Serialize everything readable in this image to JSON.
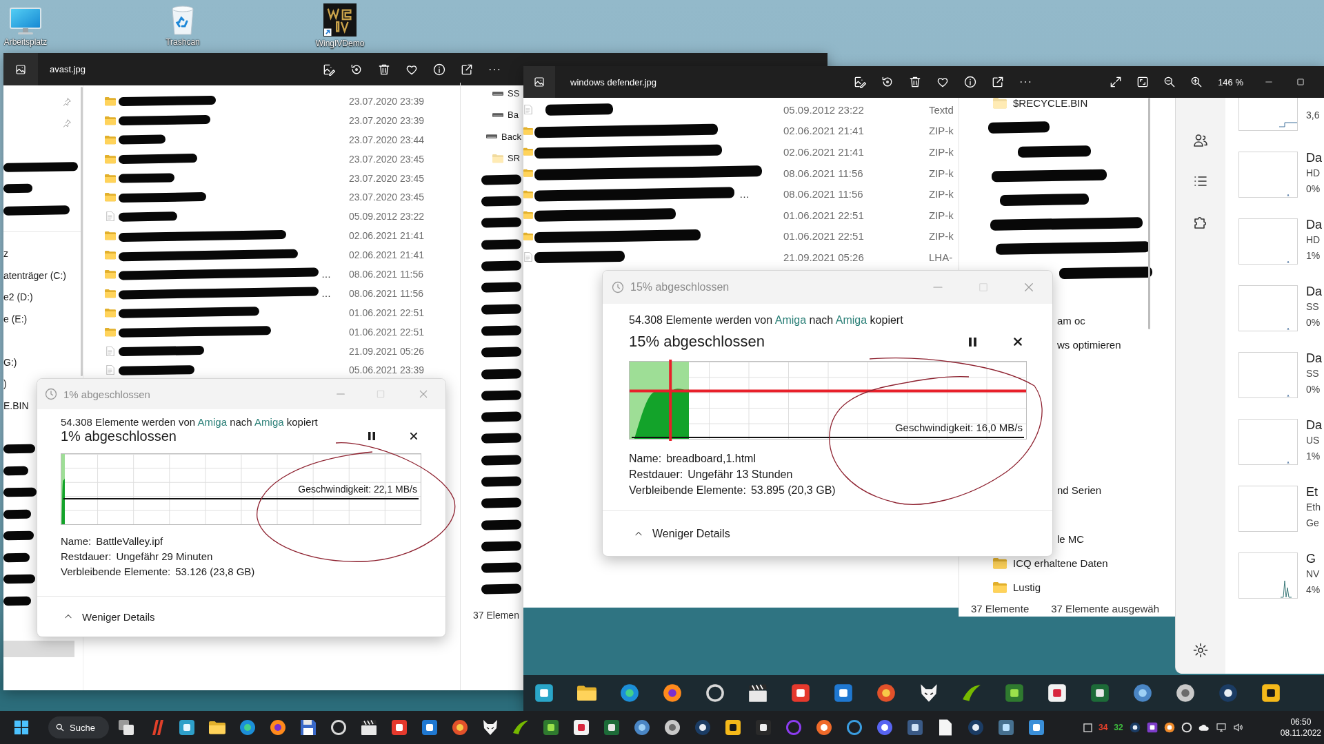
{
  "desktop_icons": [
    {
      "kind": "monitor",
      "label": "Arbeitsplatz"
    },
    {
      "kind": "recycle",
      "label": "Trashcan"
    },
    {
      "kind": "game",
      "label": "WingIVDemo"
    }
  ],
  "viewer_back": {
    "title": "avast.jpg",
    "nav_items": [
      {
        "kind": "pinned"
      },
      {
        "kind": "pinned"
      },
      {
        "kind": "redacted"
      },
      {
        "kind": "redacted"
      },
      {
        "kind": "redacted"
      },
      {
        "kind": "text",
        "label": "z"
      },
      {
        "kind": "text",
        "label": "atenträger (C:)"
      },
      {
        "kind": "text",
        "label": "e2 (D:)"
      },
      {
        "kind": "text",
        "label": "e (E:)"
      },
      {
        "kind": "text",
        "label": "G:)"
      },
      {
        "kind": "text",
        "label": ")"
      },
      {
        "kind": "text",
        "label": "E.BIN"
      },
      {
        "kind": "redacted"
      },
      {
        "kind": "redacted"
      },
      {
        "kind": "redacted"
      },
      {
        "kind": "redacted"
      },
      {
        "kind": "redacted"
      },
      {
        "kind": "redacted"
      },
      {
        "kind": "redacted"
      },
      {
        "kind": "redacted"
      }
    ],
    "files": [
      {
        "kind": "folder",
        "date": "23.07.2020 23:39"
      },
      {
        "kind": "folder",
        "date": "23.07.2020 23:39"
      },
      {
        "kind": "folder",
        "date": "23.07.2020 23:44"
      },
      {
        "kind": "folder",
        "date": "23.07.2020 23:45"
      },
      {
        "kind": "folder",
        "date": "23.07.2020 23:45"
      },
      {
        "kind": "folder",
        "date": "23.07.2020 23:45"
      },
      {
        "kind": "file",
        "date": "05.09.2012 23:22"
      },
      {
        "kind": "folder",
        "date": "02.06.2021 21:41"
      },
      {
        "kind": "folder",
        "date": "02.06.2021 21:41"
      },
      {
        "kind": "folder",
        "date": "08.06.2021 11:56",
        "tail": "…"
      },
      {
        "kind": "folder",
        "date": "08.06.2021 11:56",
        "tail": "…"
      },
      {
        "kind": "folder",
        "date": "01.06.2021 22:51"
      },
      {
        "kind": "folder",
        "date": "01.06.2021 22:51"
      },
      {
        "kind": "file",
        "date": "21.09.2021 05:26"
      },
      {
        "kind": "file",
        "date": "05.06.2021 23:39"
      }
    ],
    "side_items": [
      {
        "kind": "drive",
        "label": "SS"
      },
      {
        "kind": "drive",
        "label": "Ba"
      },
      {
        "kind": "drive_root",
        "label": "Back"
      },
      {
        "kind": "hidden_folder",
        "label": "SR"
      },
      {
        "kind": "redacted"
      },
      {
        "kind": "redacted"
      },
      {
        "kind": "redacted"
      },
      {
        "kind": "redacted"
      },
      {
        "kind": "redacted"
      },
      {
        "kind": "redacted"
      },
      {
        "kind": "redacted"
      },
      {
        "kind": "redacted"
      },
      {
        "kind": "redacted"
      },
      {
        "kind": "redacted"
      },
      {
        "kind": "redacted"
      },
      {
        "kind": "redacted"
      },
      {
        "kind": "redacted"
      },
      {
        "kind": "redacted"
      },
      {
        "kind": "redacted"
      },
      {
        "kind": "redacted"
      },
      {
        "kind": "redacted"
      },
      {
        "kind": "redacted"
      },
      {
        "kind": "redacted"
      },
      {
        "kind": "redacted"
      }
    ],
    "side_status": "37 Elemen"
  },
  "viewer_front": {
    "title": "windows defender.jpg",
    "zoom": "146 %",
    "files": [
      {
        "kind": "file",
        "date": "05.09.2012 23:22",
        "type": "Textd"
      },
      {
        "kind": "folder",
        "date": "02.06.2021 21:41",
        "type": "ZIP-k"
      },
      {
        "kind": "folder",
        "date": "02.06.2021 21:41",
        "type": "ZIP-k"
      },
      {
        "kind": "folder",
        "date": "08.06.2021 11:56",
        "type": "ZIP-k"
      },
      {
        "kind": "folder",
        "date": "08.06.2021 11:56",
        "type": "ZIP-k",
        "tail": "…"
      },
      {
        "kind": "folder",
        "date": "01.06.2021 22:51",
        "type": "ZIP-k"
      },
      {
        "kind": "folder",
        "date": "01.06.2021 22:51",
        "type": "ZIP-k"
      },
      {
        "kind": "file",
        "date": "21.09.2021 05:26",
        "type": "LHA-"
      }
    ],
    "folders": [
      {
        "kind": "hidden_folder",
        "label": "$RECYCLE.BIN"
      },
      {
        "kind": "redacted"
      },
      {
        "kind": "redacted"
      },
      {
        "kind": "redacted"
      },
      {
        "kind": "redacted"
      },
      {
        "kind": "redacted"
      },
      {
        "kind": "redacted"
      },
      {
        "kind": "redacted"
      },
      {
        "kind": "partial",
        "label": "am oc"
      },
      {
        "kind": "partial",
        "label": "ws optimieren"
      },
      {
        "kind": "partial",
        "label": "nd Serien"
      },
      {
        "kind": "partial",
        "label": "le MC"
      },
      {
        "kind": "folder",
        "label": "ICQ erhaltene Daten"
      },
      {
        "kind": "folder",
        "label": "Lustig"
      }
    ],
    "status": [
      "37 Elemente",
      "37 Elemente ausgewäh"
    ],
    "perf_items": [
      {
        "lines": [
          "3,6"
        ]
      },
      {
        "title": "Da",
        "lines": [
          "HD",
          "0%"
        ]
      },
      {
        "title": "Da",
        "lines": [
          "HD",
          "1%"
        ]
      },
      {
        "title": "Da",
        "lines": [
          "SS",
          "0%"
        ]
      },
      {
        "title": "Da",
        "lines": [
          "SS",
          "0%"
        ]
      },
      {
        "title": "Da",
        "lines": [
          "US",
          "1%"
        ]
      },
      {
        "title": "Et",
        "lines": [
          "Eth",
          "Ge"
        ]
      },
      {
        "title": "G",
        "lines": [
          "NV",
          "4%"
        ]
      }
    ]
  },
  "dialogs": [
    {
      "title": "1% abgeschlossen",
      "message": [
        {
          "kind": "plain",
          "text": "54.308 Elemente werden von"
        },
        {
          "kind": "link",
          "text": "Amiga"
        },
        {
          "kind": "plain",
          "text": "nach"
        },
        {
          "kind": "link",
          "text": "Amiga"
        },
        {
          "kind": "plain",
          "text": "kopiert"
        }
      ],
      "heading": "1% abgeschlossen",
      "level": 0.01,
      "speed": "Geschwindigkeit: 22,1 MB/s",
      "crosshair": false,
      "details": [
        {
          "label": "Name:",
          "value": "BattleValley.ipf"
        },
        {
          "label": "Restdauer:",
          "value": "Ungefähr 29 Minuten"
        },
        {
          "label": "Verbleibende Elemente:",
          "value": "53.126 (23,8 GB)"
        }
      ],
      "toggle": "Weniger Details"
    },
    {
      "title": "15% abgeschlossen",
      "message": [
        {
          "kind": "plain",
          "text": "54.308 Elemente werden von"
        },
        {
          "kind": "link",
          "text": "Amiga"
        },
        {
          "kind": "plain",
          "text": "nach"
        },
        {
          "kind": "link",
          "text": "Amiga"
        },
        {
          "kind": "plain",
          "text": "kopiert"
        }
      ],
      "heading": "15% abgeschlossen",
      "level": 0.15,
      "speed": "Geschwindigkeit: 16,0 MB/s",
      "crosshair": true,
      "details": [
        {
          "label": "Name:",
          "value": "breadboard,1.html"
        },
        {
          "label": "Restdauer:",
          "value": "Ungefähr 13 Stunden"
        },
        {
          "label": "Verbleibende Elemente:",
          "value": "53.895 (20,3 GB)"
        }
      ],
      "toggle": "Weniger Details"
    }
  ],
  "taskbar": {
    "search": "Suche",
    "tray_counters": [
      {
        "text": "34",
        "color": "#e8412c"
      },
      {
        "text": "32",
        "color": "#3fc03f"
      }
    ],
    "time": "06:50",
    "date": "08.11.2022"
  }
}
